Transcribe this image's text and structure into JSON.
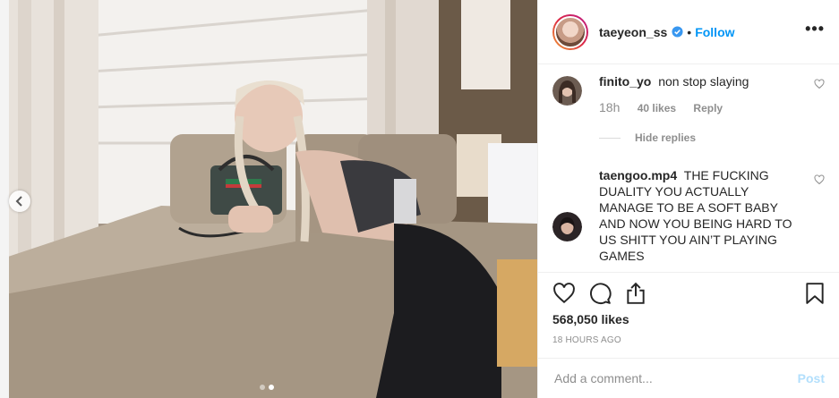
{
  "post": {
    "username": "taeyeon_ss",
    "separator": "•",
    "follow_label": "Follow",
    "more_label": "•••"
  },
  "comments": [
    {
      "username": "finito_yo",
      "text": "non stop slaying",
      "age": "18h",
      "likes": "40 likes",
      "reply_label": "Reply",
      "hide_replies_label": "Hide replies"
    },
    {
      "username": "taengoo.mp4",
      "text": "THE FUCKING DUALITY YOU ACTUALLY MANAGE TO BE A SOFT BABY AND NOW YOU BEING HARD TO US SHITT YOU AIN’T PLAYING GAMES"
    }
  ],
  "engagement": {
    "likes_count": "568,050 likes",
    "timestamp": "18 HOURS AGO"
  },
  "comment_box": {
    "placeholder": "Add a comment...",
    "post_label": "Post"
  },
  "carousel": {
    "total_slides": 2,
    "active_slide": 2
  },
  "icons": {
    "verified": "verified-badge-icon",
    "like": "heart-icon",
    "comment": "comment-bubble-icon",
    "share": "share-icon",
    "save": "bookmark-icon",
    "prev": "chevron-left-icon"
  },
  "colors": {
    "accent": "#0095f6",
    "post_disabled": "#b2dffc",
    "muted": "#8e8e8e"
  }
}
